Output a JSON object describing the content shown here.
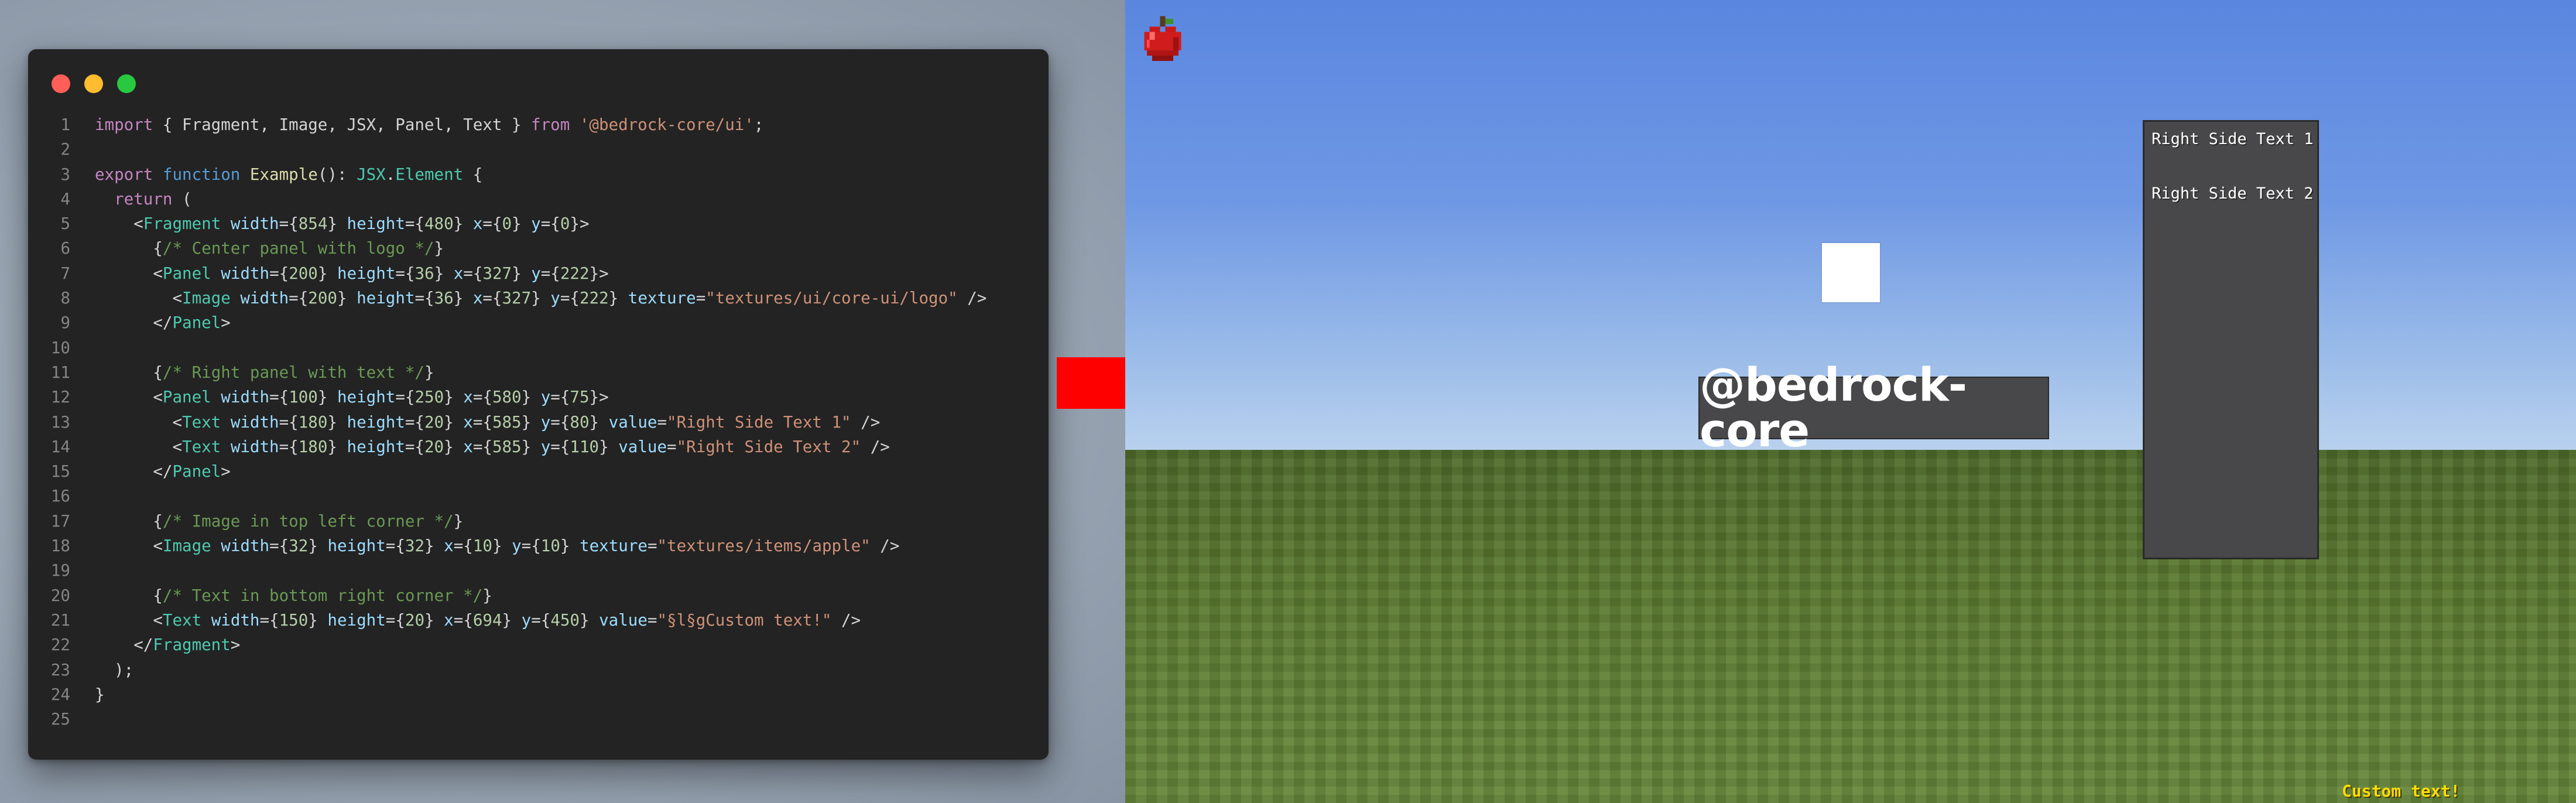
{
  "editor": {
    "traffic_lights": {
      "close_color": "#ff5f57",
      "minimize_color": "#febc2e",
      "zoom_color": "#28c840"
    },
    "lines": [
      {
        "n": "1"
      },
      {
        "n": "2"
      },
      {
        "n": "3"
      },
      {
        "n": "4"
      },
      {
        "n": "5"
      },
      {
        "n": "6"
      },
      {
        "n": "7"
      },
      {
        "n": "8"
      },
      {
        "n": "9"
      },
      {
        "n": "10"
      },
      {
        "n": "11"
      },
      {
        "n": "12"
      },
      {
        "n": "13"
      },
      {
        "n": "14"
      },
      {
        "n": "15"
      },
      {
        "n": "16"
      },
      {
        "n": "17"
      },
      {
        "n": "18"
      },
      {
        "n": "19"
      },
      {
        "n": "20"
      },
      {
        "n": "21"
      },
      {
        "n": "22"
      },
      {
        "n": "23"
      },
      {
        "n": "24"
      },
      {
        "n": "25"
      }
    ],
    "code": [
      [
        [
          "k",
          "import"
        ],
        [
          "p",
          " { Fragment, Image, JSX, Panel, Text } "
        ],
        [
          "k",
          "from"
        ],
        [
          "p",
          " "
        ],
        [
          "s",
          "'@bedrock-core/ui'"
        ],
        [
          "p",
          ";"
        ]
      ],
      [],
      [
        [
          "k",
          "export"
        ],
        [
          "p",
          " "
        ],
        [
          "kb",
          "function"
        ],
        [
          "p",
          " "
        ],
        [
          "f",
          "Example"
        ],
        [
          "p",
          "(): "
        ],
        [
          "t",
          "JSX"
        ],
        [
          "p",
          "."
        ],
        [
          "t",
          "Element"
        ],
        [
          "p",
          " {"
        ]
      ],
      [
        [
          "p",
          "  "
        ],
        [
          "k",
          "return"
        ],
        [
          "p",
          " ("
        ]
      ],
      [
        [
          "p",
          "    <"
        ],
        [
          "tag",
          "Fragment"
        ],
        [
          "p",
          " "
        ],
        [
          "a",
          "width"
        ],
        [
          "p",
          "={"
        ],
        [
          "n",
          "854"
        ],
        [
          "p",
          "} "
        ],
        [
          "a",
          "height"
        ],
        [
          "p",
          "={"
        ],
        [
          "n",
          "480"
        ],
        [
          "p",
          "} "
        ],
        [
          "a",
          "x"
        ],
        [
          "p",
          "={"
        ],
        [
          "n",
          "0"
        ],
        [
          "p",
          "} "
        ],
        [
          "a",
          "y"
        ],
        [
          "p",
          "={"
        ],
        [
          "n",
          "0"
        ],
        [
          "p",
          "}>"
        ]
      ],
      [
        [
          "p",
          "      "
        ],
        [
          "br",
          "{"
        ],
        [
          "c",
          "/* Center panel with logo */"
        ],
        [
          "br",
          "}"
        ]
      ],
      [
        [
          "p",
          "      <"
        ],
        [
          "tag",
          "Panel"
        ],
        [
          "p",
          " "
        ],
        [
          "a",
          "width"
        ],
        [
          "p",
          "={"
        ],
        [
          "n",
          "200"
        ],
        [
          "p",
          "} "
        ],
        [
          "a",
          "height"
        ],
        [
          "p",
          "={"
        ],
        [
          "n",
          "36"
        ],
        [
          "p",
          "} "
        ],
        [
          "a",
          "x"
        ],
        [
          "p",
          "={"
        ],
        [
          "n",
          "327"
        ],
        [
          "p",
          "} "
        ],
        [
          "a",
          "y"
        ],
        [
          "p",
          "={"
        ],
        [
          "n",
          "222"
        ],
        [
          "p",
          "}>"
        ]
      ],
      [
        [
          "p",
          "        <"
        ],
        [
          "tag",
          "Image"
        ],
        [
          "p",
          " "
        ],
        [
          "a",
          "width"
        ],
        [
          "p",
          "={"
        ],
        [
          "n",
          "200"
        ],
        [
          "p",
          "} "
        ],
        [
          "a",
          "height"
        ],
        [
          "p",
          "={"
        ],
        [
          "n",
          "36"
        ],
        [
          "p",
          "} "
        ],
        [
          "a",
          "x"
        ],
        [
          "p",
          "={"
        ],
        [
          "n",
          "327"
        ],
        [
          "p",
          "} "
        ],
        [
          "a",
          "y"
        ],
        [
          "p",
          "={"
        ],
        [
          "n",
          "222"
        ],
        [
          "p",
          "} "
        ],
        [
          "a",
          "texture"
        ],
        [
          "p",
          "="
        ],
        [
          "s",
          "\"textures/ui/core-ui/logo\""
        ],
        [
          "p",
          " />"
        ]
      ],
      [
        [
          "p",
          "      </"
        ],
        [
          "tag",
          "Panel"
        ],
        [
          "p",
          ">"
        ]
      ],
      [],
      [
        [
          "p",
          "      "
        ],
        [
          "br",
          "{"
        ],
        [
          "c",
          "/* Right panel with text */"
        ],
        [
          "br",
          "}"
        ]
      ],
      [
        [
          "p",
          "      <"
        ],
        [
          "tag",
          "Panel"
        ],
        [
          "p",
          " "
        ],
        [
          "a",
          "width"
        ],
        [
          "p",
          "={"
        ],
        [
          "n",
          "100"
        ],
        [
          "p",
          "} "
        ],
        [
          "a",
          "height"
        ],
        [
          "p",
          "={"
        ],
        [
          "n",
          "250"
        ],
        [
          "p",
          "} "
        ],
        [
          "a",
          "x"
        ],
        [
          "p",
          "={"
        ],
        [
          "n",
          "580"
        ],
        [
          "p",
          "} "
        ],
        [
          "a",
          "y"
        ],
        [
          "p",
          "={"
        ],
        [
          "n",
          "75"
        ],
        [
          "p",
          "}>"
        ]
      ],
      [
        [
          "p",
          "        <"
        ],
        [
          "tag",
          "Text"
        ],
        [
          "p",
          " "
        ],
        [
          "a",
          "width"
        ],
        [
          "p",
          "={"
        ],
        [
          "n",
          "180"
        ],
        [
          "p",
          "} "
        ],
        [
          "a",
          "height"
        ],
        [
          "p",
          "={"
        ],
        [
          "n",
          "20"
        ],
        [
          "p",
          "} "
        ],
        [
          "a",
          "x"
        ],
        [
          "p",
          "={"
        ],
        [
          "n",
          "585"
        ],
        [
          "p",
          "} "
        ],
        [
          "a",
          "y"
        ],
        [
          "p",
          "={"
        ],
        [
          "n",
          "80"
        ],
        [
          "p",
          "} "
        ],
        [
          "a",
          "value"
        ],
        [
          "p",
          "="
        ],
        [
          "s",
          "\"Right Side Text 1\""
        ],
        [
          "p",
          " />"
        ]
      ],
      [
        [
          "p",
          "        <"
        ],
        [
          "tag",
          "Text"
        ],
        [
          "p",
          " "
        ],
        [
          "a",
          "width"
        ],
        [
          "p",
          "={"
        ],
        [
          "n",
          "180"
        ],
        [
          "p",
          "} "
        ],
        [
          "a",
          "height"
        ],
        [
          "p",
          "={"
        ],
        [
          "n",
          "20"
        ],
        [
          "p",
          "} "
        ],
        [
          "a",
          "x"
        ],
        [
          "p",
          "={"
        ],
        [
          "n",
          "585"
        ],
        [
          "p",
          "} "
        ],
        [
          "a",
          "y"
        ],
        [
          "p",
          "={"
        ],
        [
          "n",
          "110"
        ],
        [
          "p",
          "} "
        ],
        [
          "a",
          "value"
        ],
        [
          "p",
          "="
        ],
        [
          "s",
          "\"Right Side Text 2\""
        ],
        [
          "p",
          " />"
        ]
      ],
      [
        [
          "p",
          "      </"
        ],
        [
          "tag",
          "Panel"
        ],
        [
          "p",
          ">"
        ]
      ],
      [],
      [
        [
          "p",
          "      "
        ],
        [
          "br",
          "{"
        ],
        [
          "c",
          "/* Image in top left corner */"
        ],
        [
          "br",
          "}"
        ]
      ],
      [
        [
          "p",
          "      <"
        ],
        [
          "tag",
          "Image"
        ],
        [
          "p",
          " "
        ],
        [
          "a",
          "width"
        ],
        [
          "p",
          "={"
        ],
        [
          "n",
          "32"
        ],
        [
          "p",
          "} "
        ],
        [
          "a",
          "height"
        ],
        [
          "p",
          "={"
        ],
        [
          "n",
          "32"
        ],
        [
          "p",
          "} "
        ],
        [
          "a",
          "x"
        ],
        [
          "p",
          "={"
        ],
        [
          "n",
          "10"
        ],
        [
          "p",
          "} "
        ],
        [
          "a",
          "y"
        ],
        [
          "p",
          "={"
        ],
        [
          "n",
          "10"
        ],
        [
          "p",
          "} "
        ],
        [
          "a",
          "texture"
        ],
        [
          "p",
          "="
        ],
        [
          "s",
          "\"textures/items/apple\""
        ],
        [
          "p",
          " />"
        ]
      ],
      [],
      [
        [
          "p",
          "      "
        ],
        [
          "br",
          "{"
        ],
        [
          "c",
          "/* Text in bottom right corner */"
        ],
        [
          "br",
          "}"
        ]
      ],
      [
        [
          "p",
          "      <"
        ],
        [
          "tag",
          "Text"
        ],
        [
          "p",
          " "
        ],
        [
          "a",
          "width"
        ],
        [
          "p",
          "={"
        ],
        [
          "n",
          "150"
        ],
        [
          "p",
          "} "
        ],
        [
          "a",
          "height"
        ],
        [
          "p",
          "={"
        ],
        [
          "n",
          "20"
        ],
        [
          "p",
          "} "
        ],
        [
          "a",
          "x"
        ],
        [
          "p",
          "={"
        ],
        [
          "n",
          "694"
        ],
        [
          "p",
          "} "
        ],
        [
          "a",
          "y"
        ],
        [
          "p",
          "={"
        ],
        [
          "n",
          "450"
        ],
        [
          "p",
          "} "
        ],
        [
          "a",
          "value"
        ],
        [
          "p",
          "="
        ],
        [
          "s",
          "\"§l§gCustom text!\""
        ],
        [
          "p",
          " />"
        ]
      ],
      [
        [
          "p",
          "    </"
        ],
        [
          "tag",
          "Fragment"
        ],
        [
          "p",
          ">"
        ]
      ],
      [
        [
          "p",
          "  );"
        ]
      ],
      [
        [
          "p",
          "}"
        ]
      ],
      []
    ]
  },
  "arrow": {
    "color": "#ff0000"
  },
  "scene": {
    "top_left_image": "apple-icon",
    "center_logo_box": "logo-placeholder",
    "brand_text": "@bedrock-core",
    "right_panel": {
      "text_1": "Right Side Text 1",
      "text_2": "Right Side Text 2"
    },
    "custom_text": "Custom text!",
    "custom_text_color": "#ffdd00"
  }
}
